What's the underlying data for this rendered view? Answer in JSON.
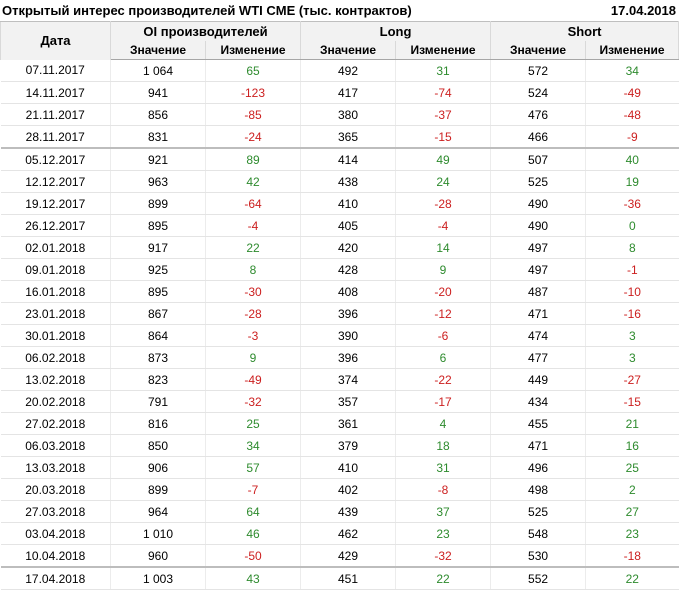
{
  "header": {
    "title": "Открытый интерес производителей WTI CME (тыс. контрактов)",
    "date": "17.04.2018"
  },
  "table": {
    "col_date": "Дата",
    "groups": [
      "OI производителей",
      "Long",
      "Short"
    ],
    "sub_value": "Значение",
    "sub_change": "Изменение",
    "month_starts": [
      4,
      23
    ],
    "rows": [
      [
        "07.11.2017",
        "1 064",
        "65",
        "492",
        "31",
        "572",
        "34"
      ],
      [
        "14.11.2017",
        "941",
        "-123",
        "417",
        "-74",
        "524",
        "-49"
      ],
      [
        "21.11.2017",
        "856",
        "-85",
        "380",
        "-37",
        "476",
        "-48"
      ],
      [
        "28.11.2017",
        "831",
        "-24",
        "365",
        "-15",
        "466",
        "-9"
      ],
      [
        "05.12.2017",
        "921",
        "89",
        "414",
        "49",
        "507",
        "40"
      ],
      [
        "12.12.2017",
        "963",
        "42",
        "438",
        "24",
        "525",
        "19"
      ],
      [
        "19.12.2017",
        "899",
        "-64",
        "410",
        "-28",
        "490",
        "-36"
      ],
      [
        "26.12.2017",
        "895",
        "-4",
        "405",
        "-4",
        "490",
        "0"
      ],
      [
        "02.01.2018",
        "917",
        "22",
        "420",
        "14",
        "497",
        "8"
      ],
      [
        "09.01.2018",
        "925",
        "8",
        "428",
        "9",
        "497",
        "-1"
      ],
      [
        "16.01.2018",
        "895",
        "-30",
        "408",
        "-20",
        "487",
        "-10"
      ],
      [
        "23.01.2018",
        "867",
        "-28",
        "396",
        "-12",
        "471",
        "-16"
      ],
      [
        "30.01.2018",
        "864",
        "-3",
        "390",
        "-6",
        "474",
        "3"
      ],
      [
        "06.02.2018",
        "873",
        "9",
        "396",
        "6",
        "477",
        "3"
      ],
      [
        "13.02.2018",
        "823",
        "-49",
        "374",
        "-22",
        "449",
        "-27"
      ],
      [
        "20.02.2018",
        "791",
        "-32",
        "357",
        "-17",
        "434",
        "-15"
      ],
      [
        "27.02.2018",
        "816",
        "25",
        "361",
        "4",
        "455",
        "21"
      ],
      [
        "06.03.2018",
        "850",
        "34",
        "379",
        "18",
        "471",
        "16"
      ],
      [
        "13.03.2018",
        "906",
        "57",
        "410",
        "31",
        "496",
        "25"
      ],
      [
        "20.03.2018",
        "899",
        "-7",
        "402",
        "-8",
        "498",
        "2"
      ],
      [
        "27.03.2018",
        "964",
        "64",
        "439",
        "37",
        "525",
        "27"
      ],
      [
        "03.04.2018",
        "1 010",
        "46",
        "462",
        "23",
        "548",
        "23"
      ],
      [
        "10.04.2018",
        "960",
        "-50",
        "429",
        "-32",
        "530",
        "-18"
      ],
      [
        "17.04.2018",
        "1 003",
        "43",
        "451",
        "22",
        "552",
        "22"
      ]
    ]
  },
  "colors": {
    "positive": "#2e8b2e",
    "negative": "#cc1f1f",
    "header_bg": "#f2f2f2"
  }
}
